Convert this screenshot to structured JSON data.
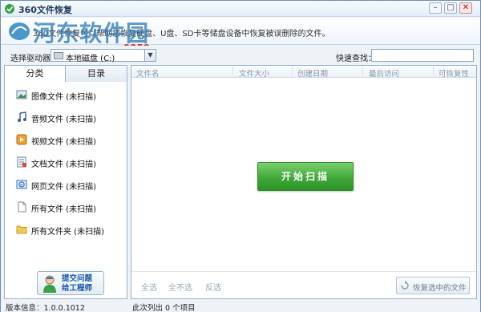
{
  "window": {
    "title": "360文件恢复",
    "controls": {
      "minimize": "–",
      "maximize": "□",
      "close": "✕"
    }
  },
  "banner": {
    "description": "360文件恢复可以帮助您恢复硬盘、U盘、SD卡等储盘设备中恢复被误删除的文件。",
    "watermark_title": "河东软件园",
    "watermark_url": "www.pc0359.cn"
  },
  "toolbar": {
    "drive_label": "选择驱动器：",
    "drive_value": "本地磁盘 (C:)",
    "search_label": "快速查找：",
    "search_value": ""
  },
  "left_panel": {
    "tabs": [
      {
        "label": "分类",
        "active": true
      },
      {
        "label": "目录",
        "active": false
      }
    ],
    "items": [
      {
        "label": "图像文件 (未扫描)",
        "icon": "image-icon"
      },
      {
        "label": "音频文件 (未扫描)",
        "icon": "music-icon"
      },
      {
        "label": "视频文件 (未扫描)",
        "icon": "video-icon"
      },
      {
        "label": "文档文件 (未扫描)",
        "icon": "document-icon"
      },
      {
        "label": "网页文件 (未扫描)",
        "icon": "webpage-icon"
      },
      {
        "label": "所有文件 (未扫描)",
        "icon": "file-icon"
      },
      {
        "label": "所有文件夹 (未扫描)",
        "icon": "folder-icon"
      }
    ],
    "support_button": {
      "line1": "提交问题",
      "line2": "给工程师"
    }
  },
  "right_panel": {
    "columns": [
      "文件名",
      "文件大小",
      "创建日期",
      "最后访问",
      "可恢复性"
    ],
    "scan_button": "开始扫描",
    "bottom_links": {
      "select_all": "全选",
      "select_none": "全不选",
      "invert": "反选"
    },
    "recover_button": "恢复选中的文件"
  },
  "statusbar": {
    "version_label": "版本信息：",
    "version": "1.0.0.1012",
    "list_count": "此次列出 0 个项目"
  },
  "colors": {
    "accent_green": "#3fa838",
    "link_blue": "#1457a5",
    "border": "#9db3c9",
    "watermark_red": "#c82828"
  }
}
